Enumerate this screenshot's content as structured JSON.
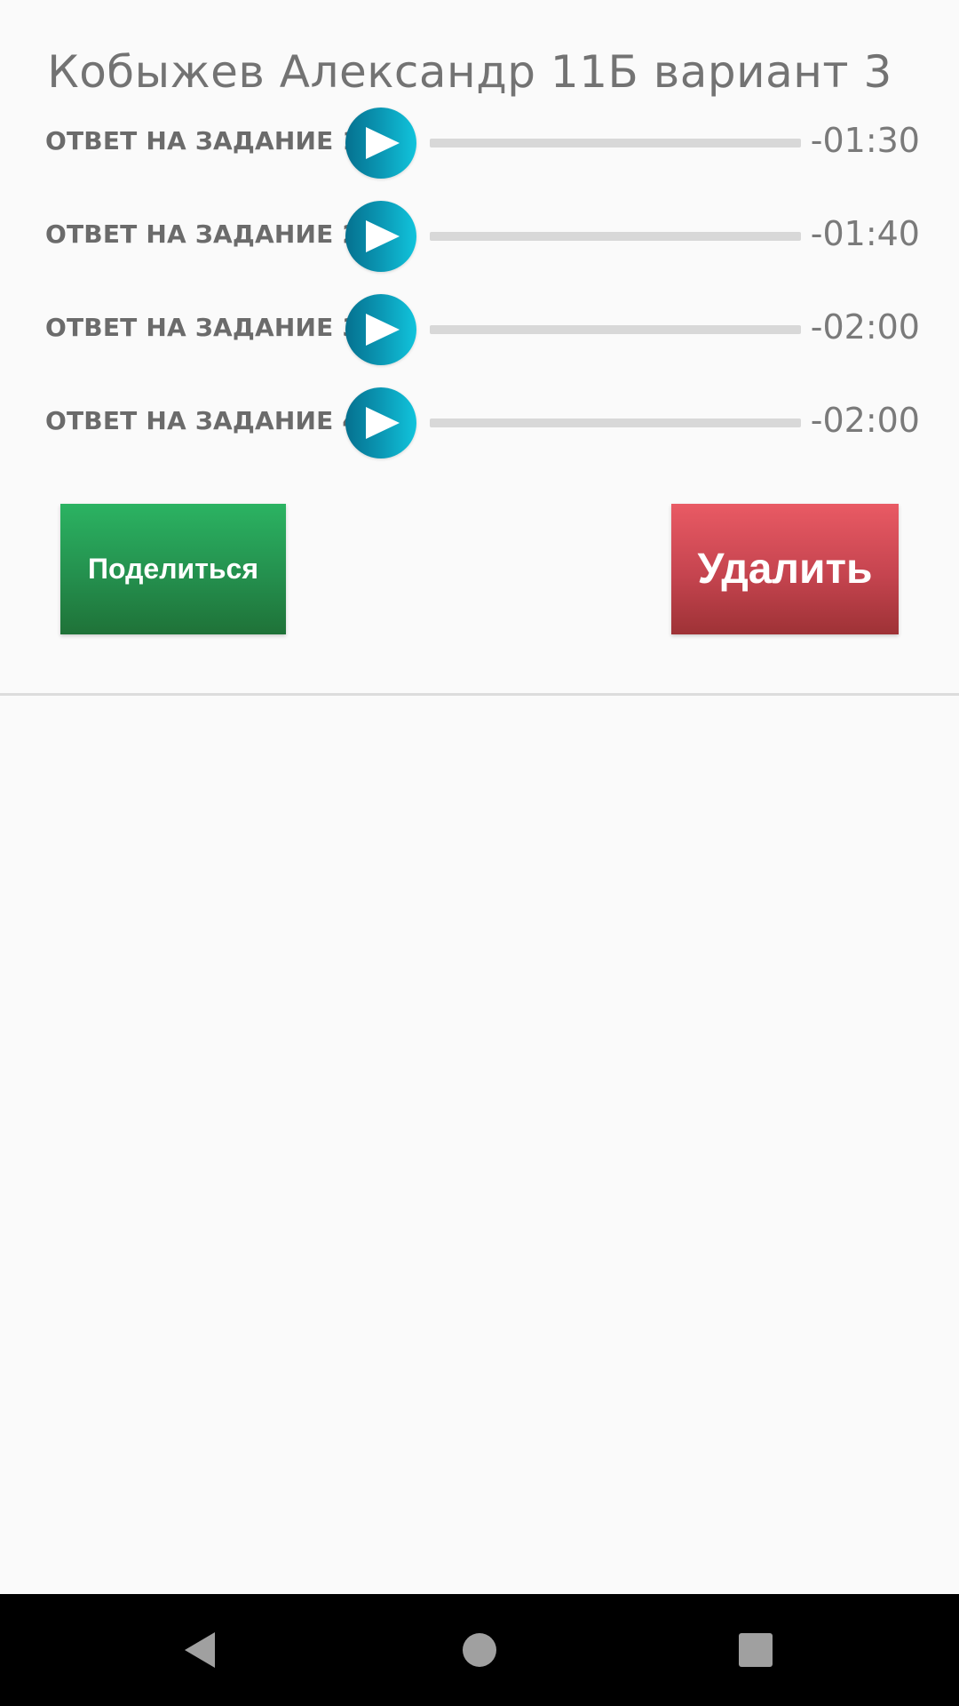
{
  "header": {
    "title": "Кобыжев Александр 11Б вариант 3"
  },
  "answers": [
    {
      "label": "ОТВЕТ НА ЗАДАНИЕ 1",
      "time": "-01:30",
      "progress": 0
    },
    {
      "label": "ОТВЕТ НА ЗАДАНИЕ 2",
      "time": "-01:40",
      "progress": 0
    },
    {
      "label": "ОТВЕТ НА ЗАДАНИЕ 3",
      "time": "-02:00",
      "progress": 0
    },
    {
      "label": "ОТВЕТ НА ЗАДАНИЕ 4",
      "time": "-02:00",
      "progress": 0
    }
  ],
  "actions": {
    "share_label": "Поделиться",
    "delete_label": "Удалить"
  },
  "icons": {
    "play": "play-icon",
    "back": "back-triangle-icon",
    "home": "home-circle-icon",
    "recents": "recents-square-icon"
  },
  "colors": {
    "share": "#27a05a",
    "delete": "#d24b55",
    "play": "#0a93b0",
    "track": "#d8d8d8",
    "navbar": "#000000"
  }
}
